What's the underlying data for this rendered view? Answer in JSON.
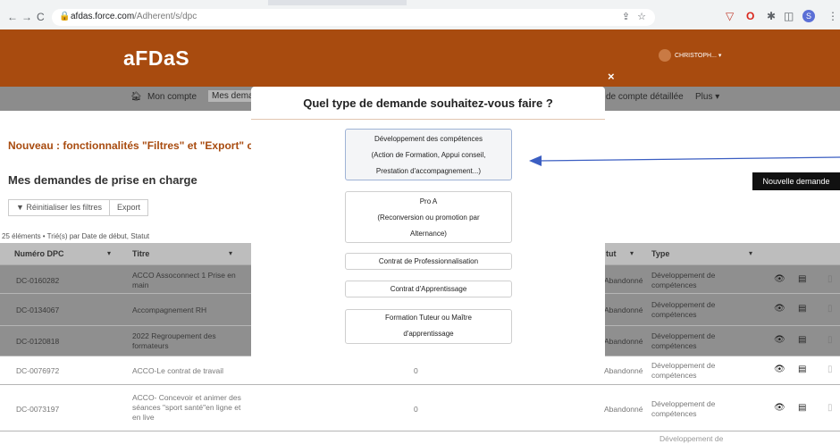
{
  "browser": {
    "url_host": "afdas.force.com",
    "url_path": "/Adherent/s/dpc"
  },
  "header": {
    "logo": "aFDaS",
    "user": "CHRISTOPH... ▾",
    "close": "×"
  },
  "nav": {
    "items": [
      "Mon compte",
      "Mes dema",
      "de compte détaillée",
      "Plus ▾"
    ]
  },
  "page": {
    "announcement": "Nouveau : fonctionnalités \"Filtres\" et \"Export\" c",
    "section_title": "Mes demandes de prise en charge",
    "new_request": "Nouvelle demande",
    "filters": [
      "Réinitialiser les filtres",
      "Export"
    ],
    "count": "25 éléments • Trié(s) par Date de début, Statut"
  },
  "table": {
    "headers": [
      "Numéro DPC",
      "Titre",
      "tut",
      "Type"
    ],
    "rows": [
      {
        "num": "DC-0160282",
        "titre": "ACCO Assoconnect 1 Prise en main",
        "mid": "",
        "statut": "Abandonné",
        "type": "Développement de compétences"
      },
      {
        "num": "DC-0134067",
        "titre": "Accompagnement RH",
        "mid": "",
        "statut": "Abandonné",
        "type": "Développement de compétences"
      },
      {
        "num": "DC-0120818",
        "titre": "2022 Regroupement des formateurs",
        "mid": "",
        "statut": "Abandonné",
        "type": "Développement de compétences"
      },
      {
        "num": "DC-0076972",
        "titre": "ACCO-Le contrat de travail",
        "mid": "0",
        "statut": "Abandonné",
        "type": "Développement de compétences"
      },
      {
        "num": "DC-0073197",
        "titre": "ACCO- Concevoir et animer des séances \"sport santé\"en ligne et en live",
        "mid": "0",
        "statut": "Abandonné",
        "type": "Développement de compétences"
      }
    ],
    "last_row_partial": "Développement de"
  },
  "modal": {
    "title": "Quel type de demande souhaitez-vous faire ?",
    "options": [
      {
        "lines": [
          "Développement des compétences",
          "(Action de Formation, Appui conseil,",
          "Prestation d'accompagnement...)"
        ]
      },
      {
        "lines": [
          "Pro A",
          "(Reconversion ou promotion par",
          "Alternance)"
        ]
      },
      {
        "lines": [
          "Contrat de Professionnalisation"
        ]
      },
      {
        "lines": [
          "Contrat d'Apprentissage"
        ]
      },
      {
        "lines": [
          "Formation Tuteur ou Maître",
          "d'apprentissage"
        ]
      }
    ]
  },
  "colors": {
    "brand": "#a84b0f",
    "arrow": "#3b5ec2"
  }
}
